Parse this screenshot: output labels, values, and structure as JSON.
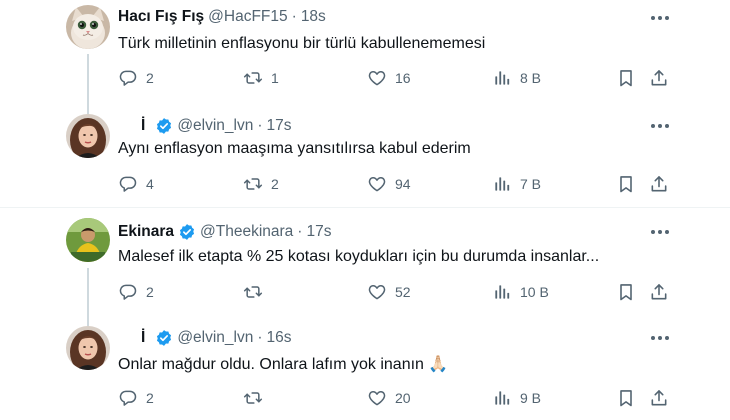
{
  "tweets": [
    {
      "name": "Hacı Fış Fış",
      "handle": "@HacFF15",
      "time": "18s",
      "text": "Türk milletinin enflasyonu bir türlü kabullenememesi",
      "replies": "2",
      "retweets": "1",
      "likes": "16",
      "views": "8 B",
      "verified": false
    },
    {
      "name": "İ",
      "handle": "@elvin_lvn",
      "time": "17s",
      "text": "Aynı enflasyon maaşıma yansıtılırsa kabul ederim",
      "replies": "4",
      "retweets": "2",
      "likes": "94",
      "views": "7 B",
      "verified": true
    },
    {
      "name": "Ekinara",
      "handle": "@Theekinara",
      "time": "17s",
      "text": "Malesef ilk etapta % 25 kotası koydukları için bu durumda insanlar...",
      "replies": "2",
      "retweets": "",
      "likes": "52",
      "views": "10 B",
      "verified": true
    },
    {
      "name": "İ",
      "handle": "@elvin_lvn",
      "time": "16s",
      "text": "Onlar mağdur oldu. Onlara lafım yok inanın 🙏🏻",
      "replies": "2",
      "retweets": "",
      "likes": "20",
      "views": "9 B",
      "verified": true
    }
  ],
  "separator": "·",
  "colors": {
    "text": "#0f1419",
    "muted": "#536471",
    "verified": "#1d9bf0",
    "thread_line": "#cfd9de",
    "divider": "#eff3f4"
  },
  "icons": [
    "reply-icon",
    "retweet-icon",
    "heart-icon",
    "views-icon",
    "bookmark-icon",
    "share-icon",
    "more-icon",
    "verified-badge-icon"
  ]
}
